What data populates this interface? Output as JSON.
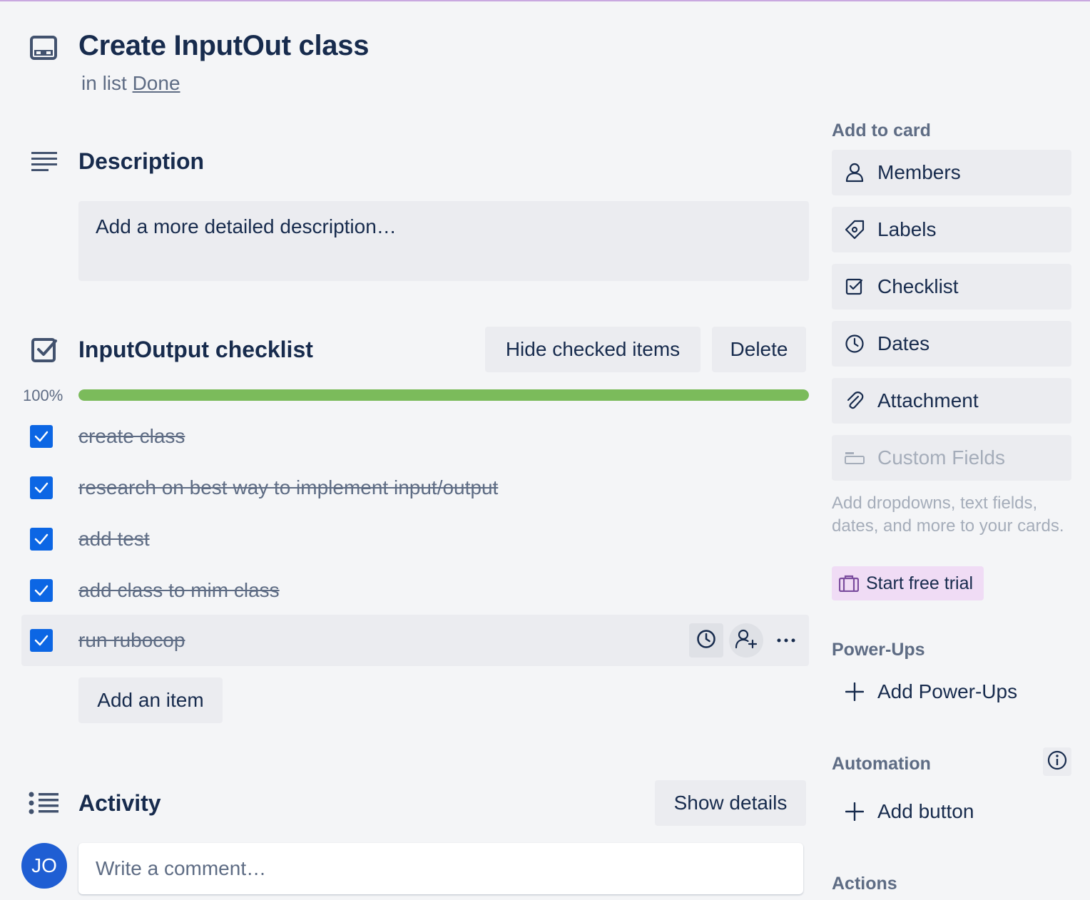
{
  "card": {
    "title": "Create InputOut class",
    "in_list_prefix": "in list",
    "list_name": "Done"
  },
  "description": {
    "heading": "Description",
    "placeholder": "Add a more detailed description…"
  },
  "checklist": {
    "title": "InputOutput checklist",
    "hide_checked_label": "Hide checked items",
    "delete_label": "Delete",
    "progress_text": "100%",
    "progress_value": 1.0,
    "items": [
      {
        "text": "create class",
        "checked": true
      },
      {
        "text": "research on best way to implement input/output",
        "checked": true
      },
      {
        "text": "add test",
        "checked": true
      },
      {
        "text": "add class to mim class",
        "checked": true
      },
      {
        "text": "run rubocop",
        "checked": true
      }
    ],
    "add_item_label": "Add an item"
  },
  "activity": {
    "heading": "Activity",
    "show_details_label": "Show details",
    "avatar_initials": "JO",
    "comment_placeholder": "Write a comment…"
  },
  "sidebar": {
    "add_to_card_heading": "Add to card",
    "buttons": [
      {
        "label": "Members",
        "icon": "person-icon"
      },
      {
        "label": "Labels",
        "icon": "tag-icon"
      },
      {
        "label": "Checklist",
        "icon": "checklist-icon"
      },
      {
        "label": "Dates",
        "icon": "clock-icon"
      },
      {
        "label": "Attachment",
        "icon": "paperclip-icon"
      },
      {
        "label": "Custom Fields",
        "icon": "custom-fields-icon",
        "disabled": true
      }
    ],
    "custom_fields_desc": "Add dropdowns, text fields, dates, and more to your cards.",
    "trial_label": "Start free trial",
    "powerups_heading": "Power-Ups",
    "add_powerups_label": "Add Power-Ups",
    "automation_heading": "Automation",
    "add_button_label": "Add button",
    "actions_heading": "Actions"
  },
  "colors": {
    "accent_blue": "#0c66e4",
    "progress_green": "#7bbb5b",
    "text_primary": "#172b4d",
    "text_subtle": "#5e6c84",
    "trial_bg": "#f0dcf5"
  }
}
